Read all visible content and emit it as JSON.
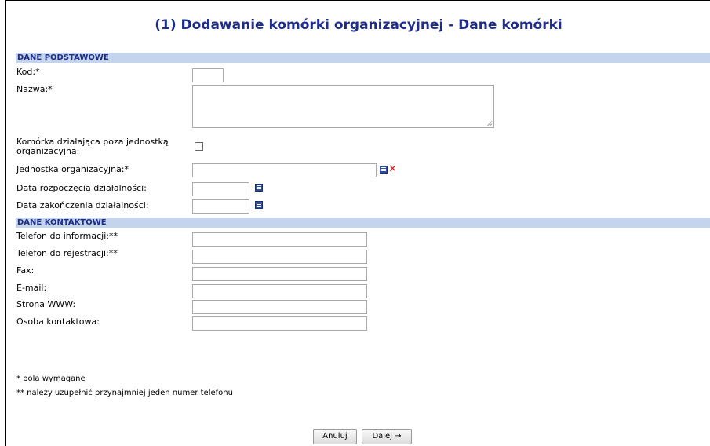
{
  "header": {
    "title": "(1) Dodawanie komórki organizacyjnej - Dane komórki"
  },
  "sections": {
    "basic": "DANE PODSTAWOWE",
    "contact": "DANE KONTAKTOWE"
  },
  "fields": {
    "kod": "Kod:*",
    "nazwa": "Nazwa:*",
    "outside_unit_line1": "Komórka działająca poza jednostką",
    "outside_unit_line2": "organizacyjną:",
    "unit": "Jednostka organizacyjna:*",
    "start_date": "Data rozpoczęcia działalności:",
    "end_date": "Data zakończenia działalności:",
    "phone_info": "Telefon do informacji:**",
    "phone_reg": "Telefon do rejestracji:**",
    "fax": "Fax:",
    "email": "E-mail:",
    "www": "Strona WWW:",
    "contact_person": "Osoba kontaktowa:"
  },
  "notes": {
    "required": "*  pola wymagane",
    "phone": "** należy uzupełnić przynajmniej jeden numer telefonu"
  },
  "buttons": {
    "cancel": "Anuluj",
    "next": "Dalej →"
  },
  "icons": {
    "calendar": "calendar-icon",
    "delete": "✕"
  },
  "colors": {
    "title": "#1e2d8a",
    "section_bg": "#c4d4ec",
    "delete": "#e02020"
  }
}
